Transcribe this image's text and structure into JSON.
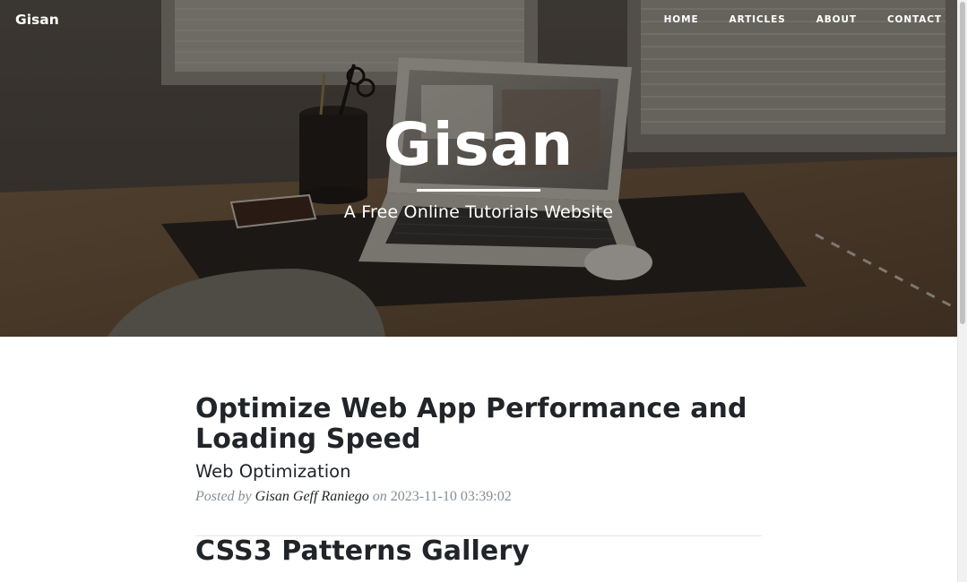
{
  "navbar": {
    "brand": "Gisan",
    "links": [
      "HOME",
      "ARTICLES",
      "ABOUT",
      "CONTACT"
    ]
  },
  "hero": {
    "title": "Gisan",
    "subheading": "A Free Online Tutorials Website"
  },
  "posts": [
    {
      "title": "Optimize Web App Performance and Loading Speed",
      "subtitle": "Web Optimization",
      "meta_prefix": "Posted by",
      "author": "Gisan Geff Raniego",
      "meta_on": "on",
      "date": "2023-11-10 03:39:02"
    },
    {
      "title": "CSS3 Patterns Gallery"
    }
  ],
  "colors": {
    "text": "#212529",
    "muted": "#868e96",
    "divider": "#e5e5e5"
  }
}
